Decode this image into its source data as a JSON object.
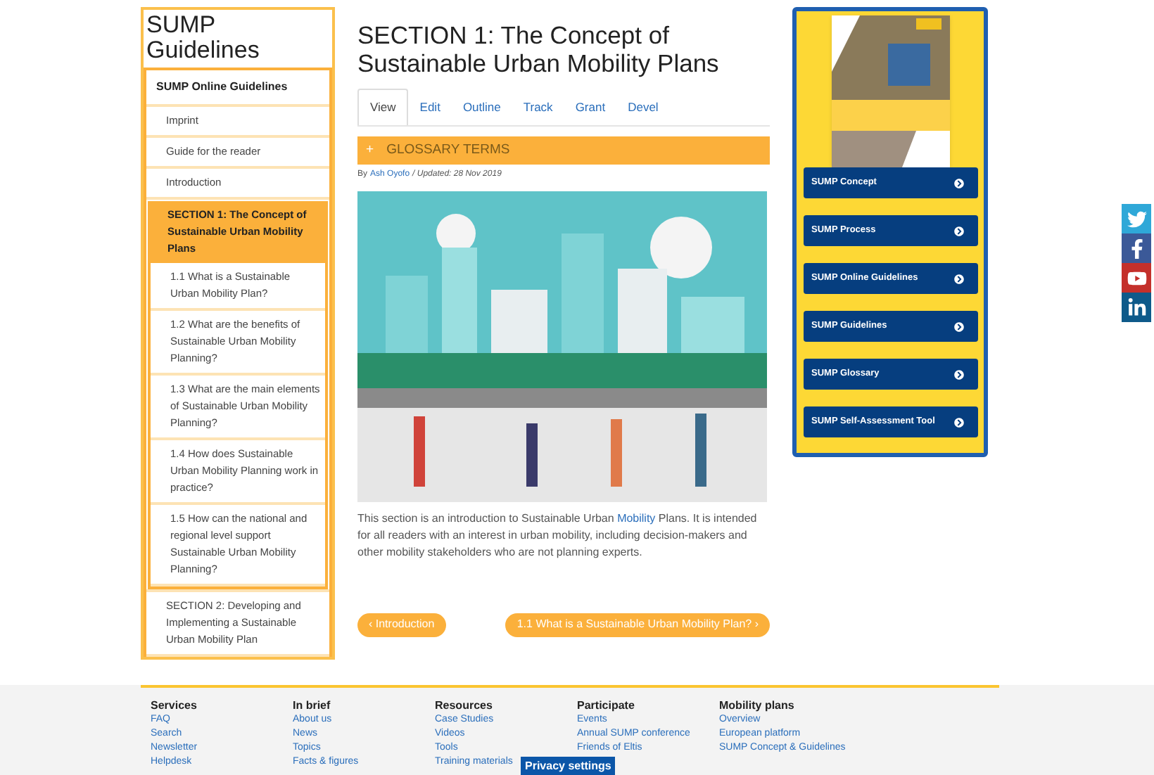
{
  "sidebar": {
    "title": "SUMP Guidelines",
    "header": "SUMP Online Guidelines",
    "items": [
      {
        "label": "Imprint",
        "selected": false
      },
      {
        "label": "Guide for the reader",
        "selected": false
      },
      {
        "label": "Introduction",
        "selected": false
      },
      {
        "label": "SECTION 1: The Concept of Sustainable Urban Mobility Plans",
        "selected": true,
        "children": [
          {
            "label": "1.1 What is a Sustainable Urban Mobility Plan?",
            "selected": false
          },
          {
            "label": "1.2 What are the benefits of Sustainable Urban Mobility Planning?",
            "selected": false
          },
          {
            "label": "1.3 What are the main elements of Sustainable Urban Mobility Planning?",
            "selected": false
          },
          {
            "label": "1.4 How does Sustainable Urban Mobility Planning work in practice?",
            "selected": false
          },
          {
            "label": "1.5 How can the national and regional level support Sustainable Urban Mobility Planning?",
            "selected": false
          }
        ]
      },
      {
        "label": "SECTION 2: Developing and Implementing a Sustainable Urban Mobility Plan",
        "selected": false
      }
    ]
  },
  "page": {
    "title": "SECTION 1: The Concept of Sustainable Urban Mobility Plans",
    "tabs": [
      {
        "label": "View",
        "selected": true
      },
      {
        "label": "Edit",
        "selected": false
      },
      {
        "label": "Outline",
        "selected": false
      },
      {
        "label": "Track",
        "selected": false
      },
      {
        "label": "Grant",
        "selected": false
      },
      {
        "label": "Devel",
        "selected": false
      }
    ],
    "glossary": {
      "icon": "+",
      "label": "GLOSSARY TERMS"
    },
    "byline": {
      "prefix": "By",
      "author": "Ash Oyofo",
      "updated": "/ Updated: 28 Nov 2019"
    },
    "intro": {
      "before": "This section is an introduction to Sustainable Urban",
      "link": "Mobility",
      "after": "Plans. It is intended for all readers with an interest in urban mobility, including decision-makers and other mobility stakeholders who are not planning experts."
    },
    "prev": "‹ Introduction",
    "next": "1.1 What is a Sustainable Urban Mobility Plan? ›"
  },
  "promo": {
    "buttons": [
      "SUMP Concept",
      "SUMP Process",
      "SUMP Online Guidelines",
      "SUMP Guidelines",
      "SUMP Glossary",
      "SUMP Self-Assessment Tool"
    ]
  },
  "social": [
    {
      "kind": "twitter",
      "color": "#2fa8d8"
    },
    {
      "kind": "facebook",
      "color": "#3b5998"
    },
    {
      "kind": "youtube",
      "color": "#c4302b"
    },
    {
      "kind": "linkedin",
      "color": "#0e5a8a"
    }
  ],
  "footer": {
    "columns": [
      {
        "heading": "Services",
        "links": [
          "FAQ",
          "Search",
          "Newsletter",
          "Helpdesk"
        ]
      },
      {
        "heading": "In brief",
        "links": [
          "About us",
          "News",
          "Topics",
          "Facts & figures"
        ]
      },
      {
        "heading": "Resources",
        "links": [
          "Case Studies",
          "Videos",
          "Tools",
          "Training materials"
        ]
      },
      {
        "heading": "Participate",
        "links": [
          "Events",
          "Annual SUMP conference",
          "Friends of Eltis"
        ]
      },
      {
        "heading": "Mobility plans",
        "links": [
          "Overview",
          "European platform",
          "SUMP Concept & Guidelines"
        ]
      }
    ],
    "privacy": "Privacy settings"
  }
}
